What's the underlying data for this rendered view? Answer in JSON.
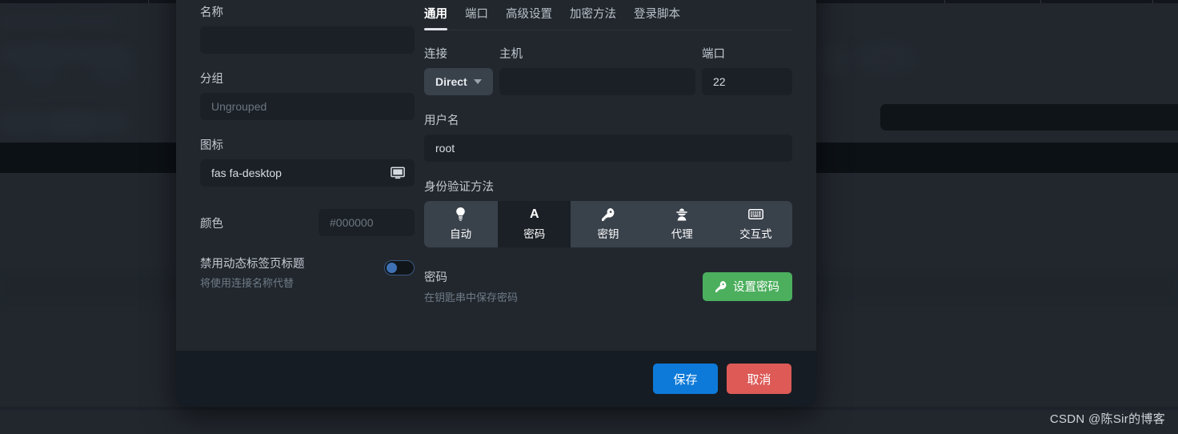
{
  "watermark": "CSDN @陈Sir的博客",
  "modal": {
    "left_panel": {
      "name_label": "名称",
      "name_value": "",
      "name_placeholder": "",
      "group_label": "分组",
      "group_value": "",
      "group_placeholder": "Ungrouped",
      "icon_label": "图标",
      "icon_value": "fas fa-desktop",
      "icon_glyph": "monitor-icon",
      "color_label": "颜色",
      "color_value": "",
      "color_placeholder": "#000000",
      "toggle_title": "禁用动态标签页标题",
      "toggle_sub": "将使用连接名称代替",
      "toggle_state": "off"
    },
    "tabs": [
      {
        "label": "通用",
        "active": true
      },
      {
        "label": "端口",
        "active": false
      },
      {
        "label": "高级设置",
        "active": false
      },
      {
        "label": "加密方法",
        "active": false
      },
      {
        "label": "登录脚本",
        "active": false
      }
    ],
    "general": {
      "connect_label": "连接",
      "connect_value": "Direct",
      "host_label": "主机",
      "host_value": "",
      "host_placeholder": "",
      "port_label": "端口",
      "port_value": "22",
      "username_label": "用户名",
      "username_value": "root",
      "auth_label": "身份验证方法",
      "auth_methods": [
        {
          "label": "自动",
          "icon": "lightbulb-icon",
          "active": false
        },
        {
          "label": "密码",
          "icon": "letter-a-icon",
          "active": true
        },
        {
          "label": "密钥",
          "icon": "key-icon",
          "active": false
        },
        {
          "label": "代理",
          "icon": "user-secret-icon",
          "active": false
        },
        {
          "label": "交互式",
          "icon": "keyboard-icon",
          "active": false
        }
      ],
      "password_title": "密码",
      "password_sub": "在钥匙串中保存密码",
      "set_password_button": "设置密码",
      "set_password_icon": "key-icon"
    },
    "footer": {
      "save_label": "保存",
      "cancel_label": "取消"
    }
  },
  "colors": {
    "modal_bg": "#22272e",
    "footer_bg": "#161c23",
    "input_bg": "#1b2026",
    "select_bg": "#39414b",
    "accent_blue": "#0d7ad9",
    "danger_red": "#dd5a57",
    "green": "#4caf5e",
    "toggle_knob": "#3f72b4"
  }
}
